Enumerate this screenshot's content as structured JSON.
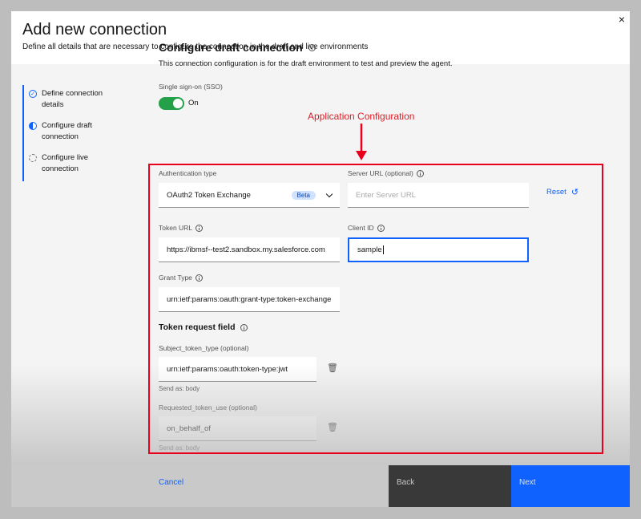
{
  "modal": {
    "title": "Add new connection",
    "subtitle": "Define all details that are necessary to configure the connection in the draft and live environments",
    "close_icon": "×"
  },
  "steps": [
    {
      "label": "Define connection details",
      "state": "complete"
    },
    {
      "label": "Configure draft connection",
      "state": "current"
    },
    {
      "label": "Configure live connection",
      "state": "incomplete"
    }
  ],
  "config": {
    "title": "Configure draft connection",
    "description": "This connection configuration is for the draft environment to test and preview the agent.",
    "sso_label": "Single sign-on (SSO)",
    "sso_state": "On"
  },
  "annotation": {
    "label": "Application Configuration",
    "color": "#e8001c"
  },
  "fields": {
    "auth_type": {
      "label": "Authentication type",
      "value": "OAuth2 Token Exchange",
      "badge": "Beta"
    },
    "server_url": {
      "label": "Server URL (optional)",
      "placeholder": "Enter Server URL"
    },
    "reset": "Reset",
    "token_url": {
      "label": "Token URL",
      "value": "https://ibmsf--test2.sandbox.my.salesforce.com"
    },
    "client_id": {
      "label": "Client ID",
      "value": "sample"
    },
    "grant_type": {
      "label": "Grant Type",
      "value": "urn:ietf:params:oauth:grant-type:token-exchange"
    }
  },
  "token_request": {
    "title": "Token request field",
    "subject_token_type": {
      "label": "Subject_token_type (optional)",
      "value": "urn:ietf:params:oauth:token-type:jwt",
      "send_as": "Send as: body"
    },
    "requested_token_use": {
      "label": "Requested_token_use (optional)",
      "value": "on_behalf_of",
      "send_as": "Send as: body"
    }
  },
  "footer": {
    "cancel": "Cancel",
    "back": "Back",
    "next": "Next"
  },
  "colors": {
    "primary": "#0f62fe",
    "toggle_on": "#24a148",
    "annotation": "#e8001c"
  }
}
